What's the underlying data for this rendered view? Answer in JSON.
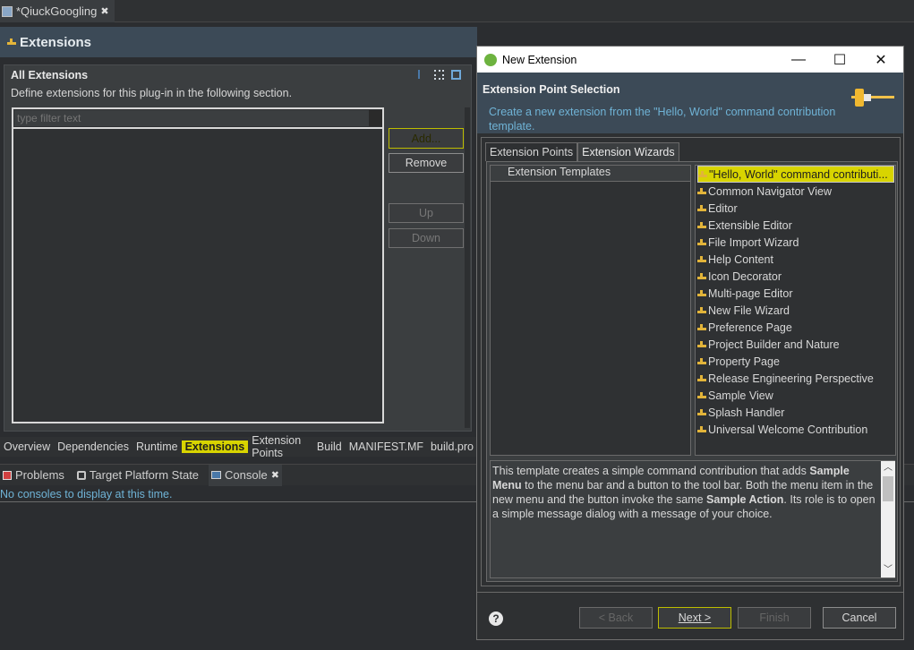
{
  "editor_tab": {
    "title": "*QiuckGoogling",
    "close": "✖"
  },
  "form": {
    "title": "Extensions",
    "section_title": "All Extensions",
    "section_desc": "Define extensions for this plug-in in the following section.",
    "filter_placeholder": "type filter text",
    "buttons": {
      "add": "Add...",
      "remove": "Remove",
      "up": "Up",
      "down": "Down"
    }
  },
  "pages": [
    "Overview",
    "Dependencies",
    "Runtime",
    "Extensions",
    "Extension Points",
    "Build",
    "MANIFEST.MF",
    "build.pro"
  ],
  "views": {
    "problems": "Problems",
    "target": "Target Platform State",
    "console": "Console",
    "console_message": "No consoles to display at this time."
  },
  "dialog": {
    "title": "New Extension",
    "header_title": "Extension Point Selection",
    "header_desc": "Create a new extension from the \"Hello, World\" command contribution template.",
    "tabs": [
      "Extension Points",
      "Extension Wizards"
    ],
    "left_header": "Extension Templates",
    "templates": [
      "\"Hello, World\" command contributi...",
      "Common Navigator View",
      "Editor",
      "Extensible Editor",
      "File Import Wizard",
      "Help Content",
      "Icon Decorator",
      "Multi-page Editor",
      "New File Wizard",
      "Preference Page",
      "Project Builder and Nature",
      "Property Page",
      "Release Engineering Perspective",
      "Sample View",
      "Splash Handler",
      "Universal Welcome Contribution"
    ],
    "description": {
      "t1": "This template creates a simple command contribution that adds ",
      "b1": "Sample Menu",
      "t2": " to the menu bar and a button to the tool bar. Both the menu item in the new menu and the button invoke the same ",
      "b2": "Sample Action",
      "t3": ". Its role is to open a simple message dialog with a message of your choice."
    },
    "buttons": {
      "back": "< Back",
      "next": "Next >",
      "finish": "Finish",
      "cancel": "Cancel"
    },
    "help": "?"
  },
  "colors": {
    "highlight": "#d8d400",
    "header": "#3c4a57",
    "link": "#6fb3d6"
  }
}
